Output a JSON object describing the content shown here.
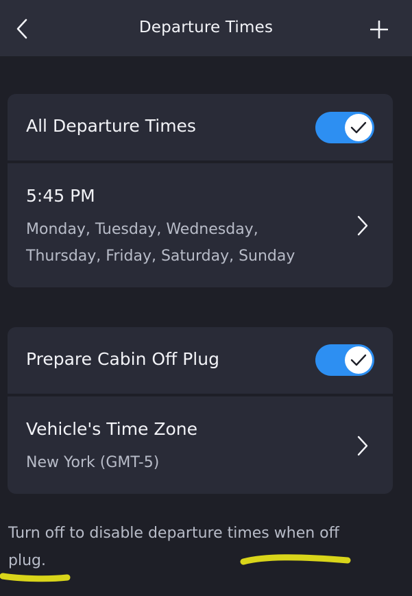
{
  "header": {
    "title": "Departure Times",
    "back_icon": "chevron-left-icon",
    "add_icon": "plus-icon"
  },
  "departure_card": {
    "all_departure_times": {
      "label": "All Departure Times",
      "enabled": true
    },
    "schedule": {
      "time": "5:45 PM",
      "days_line1": "Monday, Tuesday, Wednesday,",
      "days_line2": "Thursday, Friday, Saturday, Sunday"
    }
  },
  "cabin_card": {
    "prepare_cabin": {
      "label": "Prepare Cabin Off Plug",
      "enabled": true
    },
    "time_zone": {
      "label": "Vehicle's Time Zone",
      "value": "New York (GMT-5)"
    }
  },
  "footnote": {
    "text": "Turn off to disable departure times when off plug."
  },
  "colors": {
    "background": "#1e1f27",
    "header": "#2c2e3a",
    "card": "#292b37",
    "toggle_on": "#2d8ff2",
    "highlight_marker": "#d9d51a"
  }
}
